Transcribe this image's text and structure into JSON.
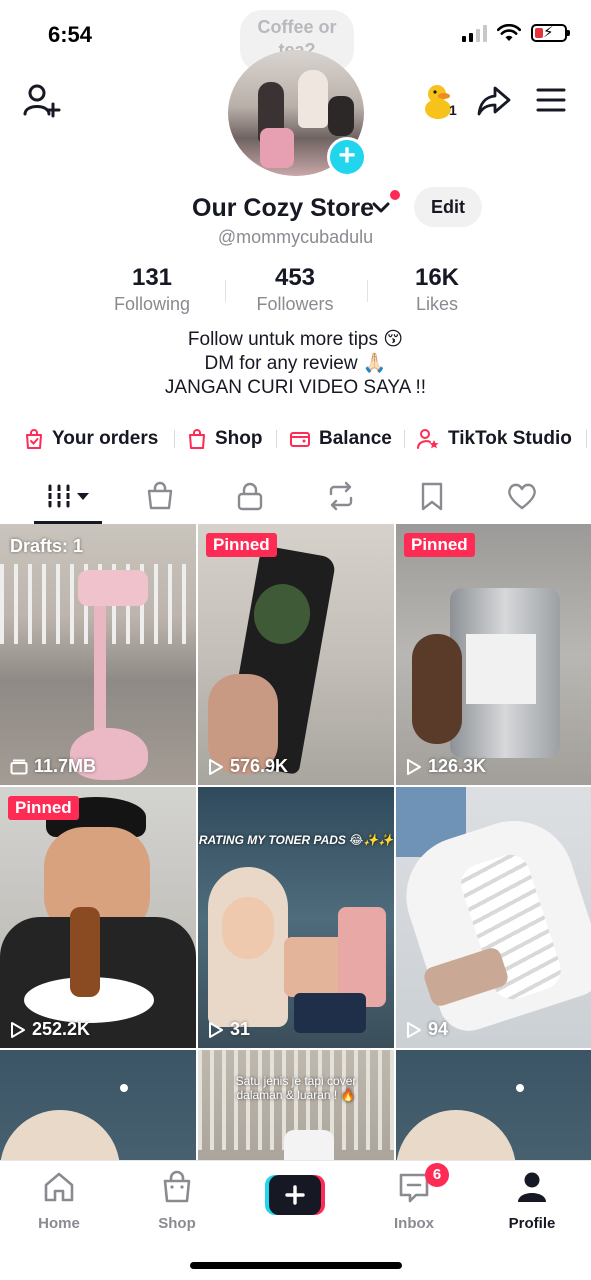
{
  "status_bar": {
    "time": "6:54"
  },
  "note": "Coffee or tea?",
  "header": {
    "pet_count": "1"
  },
  "profile": {
    "display_name": "Our Cozy Store",
    "handle": "@mommycubadulu",
    "edit_label": "Edit"
  },
  "stats": [
    {
      "value": "131",
      "label": "Following"
    },
    {
      "value": "453",
      "label": "Followers"
    },
    {
      "value": "16K",
      "label": "Likes"
    }
  ],
  "bio": [
    "Follow untuk more tips 😚",
    "DM for any review 🙏🏻",
    "JANGAN CURI VIDEO SAYA !!"
  ],
  "quick_links": [
    {
      "label": "Your orders",
      "icon": "orders-bag-icon"
    },
    {
      "label": "Shop",
      "icon": "shopping-bag-icon"
    },
    {
      "label": "Balance",
      "icon": "wallet-icon"
    },
    {
      "label": "TikTok Studio",
      "icon": "studio-person-star-icon"
    }
  ],
  "tabs": [
    "videos-grid-icon",
    "shop-bag-icon",
    "lock-icon",
    "repost-icon",
    "bookmark-icon",
    "heart-icon"
  ],
  "videos": [
    {
      "overlay": "Drafts: 1",
      "stat": "11.7MB",
      "stat_icon": "drafts-folder-icon"
    },
    {
      "badge": "Pinned",
      "stat": "576.9K",
      "stat_icon": "play-icon"
    },
    {
      "badge": "Pinned",
      "stat": "126.3K",
      "stat_icon": "play-icon"
    },
    {
      "badge": "Pinned",
      "stat": "252.2K",
      "stat_icon": "play-icon"
    },
    {
      "caption": "RATING MY TONER PADS 😂✨✨",
      "stat": "31",
      "stat_icon": "play-icon"
    },
    {
      "stat": "94",
      "stat_icon": "play-icon"
    },
    {},
    {
      "caption": "Satu jenis je tapi cover dalaman & luaran ! 🔥"
    },
    {}
  ],
  "bottom_nav": {
    "home": "Home",
    "shop": "Shop",
    "inbox": "Inbox",
    "inbox_badge": "6",
    "profile": "Profile"
  }
}
